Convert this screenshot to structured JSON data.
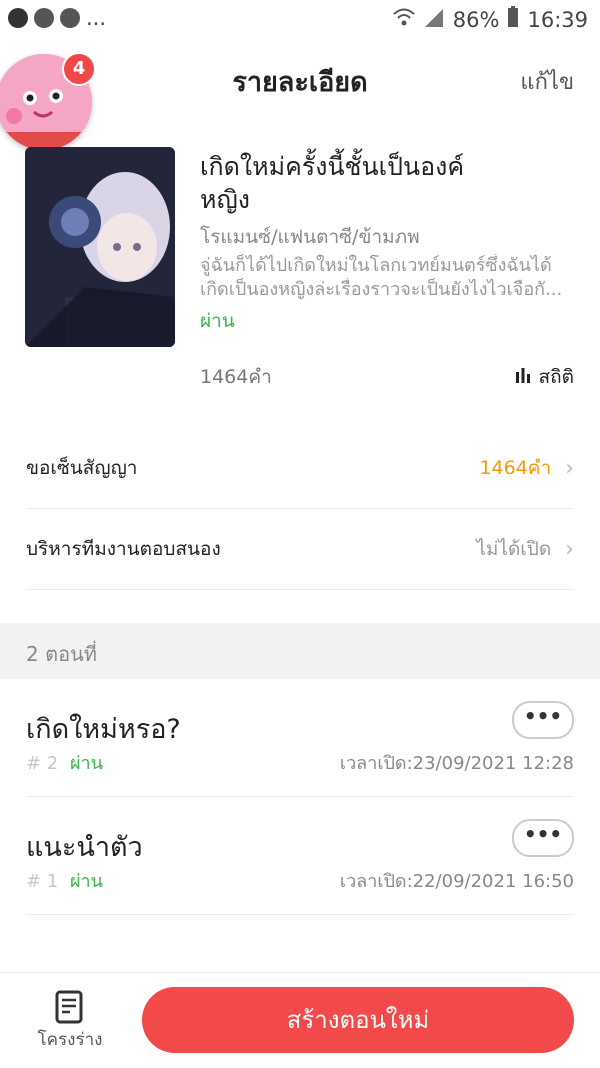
{
  "status_bar": {
    "left_extra": "...",
    "battery": "86%",
    "time": "16:39"
  },
  "header": {
    "title": "รายละเอียด",
    "edit_label": "แก้ไข"
  },
  "notification_badge": "4",
  "book": {
    "title_line1": "เกิดใหม่ครั้งนี้ชั้นเป็นองค์",
    "title_line2": "หญิง",
    "genre": "โรแมนซ์/แฟนตาซี/ข้ามภพ",
    "desc_line1": "จู่ฉันก็ได้ไปเกิดใหม่ในโลกเวทย์มนตร์ซึ่งฉันได้",
    "desc_line2": "เกิดเป็นองหญิงล่ะเรื่องราวจะเป็นยังไงไวเจือกั...",
    "status": "ผ่าน",
    "word_count": "1464คำ",
    "stats_label": "สถิติ"
  },
  "rows": [
    {
      "label": "ขอเซ็นสัญญา",
      "value": "1464คำ",
      "value_color": "#f59a00"
    },
    {
      "label": "บริหารทีมงานตอบสนอง",
      "value": "ไม่ได้เปิด",
      "value_color": "#999999"
    }
  ],
  "episodes_header": "2 ตอนที่",
  "episodes": [
    {
      "title": "เกิดใหม่หรอ?",
      "num": "# 2",
      "status": "ผ่าน",
      "time": "เวลาเปิด:23/09/2021 12:28"
    },
    {
      "title": "แนะนำตัว",
      "num": "# 1",
      "status": "ผ่าน",
      "time": "เวลาเปิด:22/09/2021 16:50"
    }
  ],
  "more_label": "•••",
  "bottom": {
    "outline_label": "โครงร่าง",
    "create_label": "สร้างตอนใหม่"
  },
  "colors": {
    "accent": "#f24a4a",
    "pass": "#3bb24a",
    "contract_value": "#f59a00"
  }
}
